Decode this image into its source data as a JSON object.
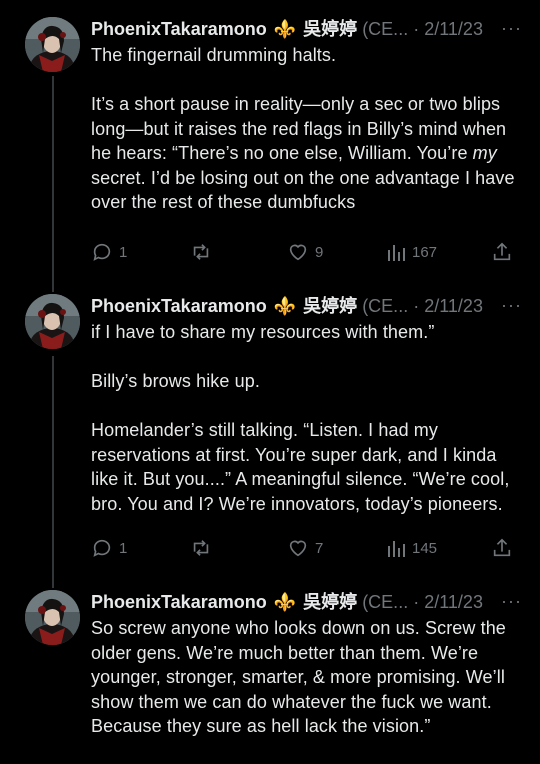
{
  "colors": {
    "background": "#000000",
    "text": "#e7e9ea",
    "secondary": "#71767b",
    "thread_line": "#333639",
    "emoji": "#d8a32a"
  },
  "tweets": [
    {
      "display_name": "PhoenixTakaramono",
      "emoji": "⚜️",
      "cjk_name": "吳婷婷",
      "handle": "(CE...",
      "separator": "·",
      "date": "2/11/23",
      "more": "···",
      "paragraphs": [
        [
          "The fingernail drumming halts."
        ],
        [
          "It’s a short pause in reality—only a sec or two blips long—but it raises the red flags in Billy’s mind when he hears: “There’s no one else, William. You’re ",
          "my",
          " secret. I’d be losing out on the one advantage I have over the rest of these dumbfucks"
        ]
      ],
      "replies": "1",
      "retweets": "",
      "likes": "9",
      "views": "167"
    },
    {
      "display_name": "PhoenixTakaramono",
      "emoji": "⚜️",
      "cjk_name": "吳婷婷",
      "handle": "(CE...",
      "separator": "·",
      "date": "2/11/23",
      "more": "···",
      "paragraphs": [
        [
          "if I have to share my resources with them.”"
        ],
        [
          "Billy’s brows hike up."
        ],
        [
          "Homelander’s still talking. “Listen. I had my reservations at first. You’re super dark, and I kinda like it. But you....” A meaningful silence. “We’re cool, bro. You and I? We’re innovators, today’s pioneers."
        ]
      ],
      "replies": "1",
      "retweets": "",
      "likes": "7",
      "views": "145"
    },
    {
      "display_name": "PhoenixTakaramono",
      "emoji": "⚜️",
      "cjk_name": "吳婷婷",
      "handle": "(CE...",
      "separator": "·",
      "date": "2/11/23",
      "more": "···",
      "paragraphs": [
        [
          "So screw anyone who looks down on us. Screw the older gens. We’re much better than them. We’re younger, stronger, smarter, & more promising. We’ll show them we can do whatever the fuck we want. Because they sure as hell lack the vision.”"
        ]
      ]
    }
  ]
}
